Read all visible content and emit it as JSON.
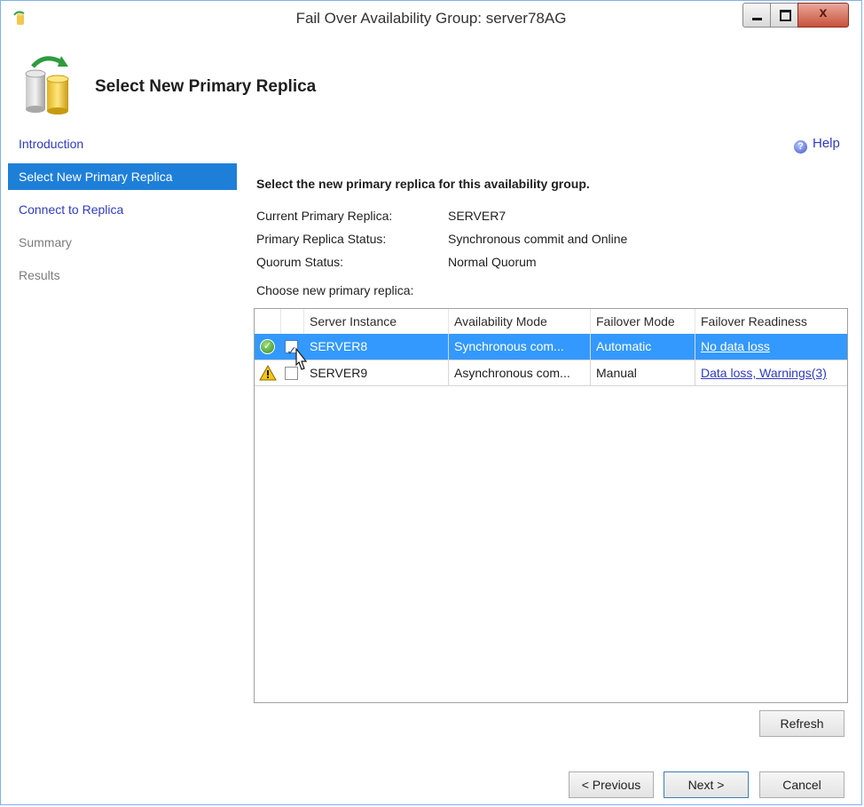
{
  "window": {
    "title": "Fail Over Availability Group: server78AG",
    "close_glyph": "x"
  },
  "header": {
    "title": "Select New Primary Replica",
    "icon": "database-failover-icon"
  },
  "nav": {
    "items": [
      {
        "label": "Introduction",
        "state": "link"
      },
      {
        "label": "Select New Primary Replica",
        "state": "active"
      },
      {
        "label": "Connect to Replica",
        "state": "link"
      },
      {
        "label": "Summary",
        "state": "disabled"
      },
      {
        "label": "Results",
        "state": "disabled"
      }
    ]
  },
  "help": {
    "label": "Help",
    "icon": "help-icon"
  },
  "main": {
    "instruction": "Select the new primary replica for this availability group.",
    "info": [
      {
        "label": "Current Primary Replica:",
        "value": "SERVER7"
      },
      {
        "label": "Primary Replica Status:",
        "value": "Synchronous commit and Online"
      },
      {
        "label": "Quorum Status:",
        "value": "Normal Quorum"
      }
    ],
    "choose_label": "Choose new primary replica:",
    "grid": {
      "columns": [
        "Server Instance",
        "Availability Mode",
        "Failover Mode",
        "Failover Readiness"
      ],
      "rows": [
        {
          "status_icon": "check-circle-icon",
          "checked": true,
          "server": "SERVER8",
          "availability_mode": "Synchronous com...",
          "failover_mode": "Automatic",
          "readiness": "No data loss",
          "selected": true
        },
        {
          "status_icon": "warning-icon",
          "checked": false,
          "server": "SERVER9",
          "availability_mode": "Asynchronous com...",
          "failover_mode": "Manual",
          "readiness": "Data loss, Warnings(3)",
          "selected": false
        }
      ]
    },
    "refresh_label": "Refresh"
  },
  "footer": {
    "previous_label": "< Previous",
    "next_label": "Next >",
    "cancel_label": "Cancel"
  },
  "colors": {
    "accent": "#1e7fd8",
    "selection": "#3399ff",
    "link": "#2e3bbf",
    "close_button": "#c9513c"
  }
}
